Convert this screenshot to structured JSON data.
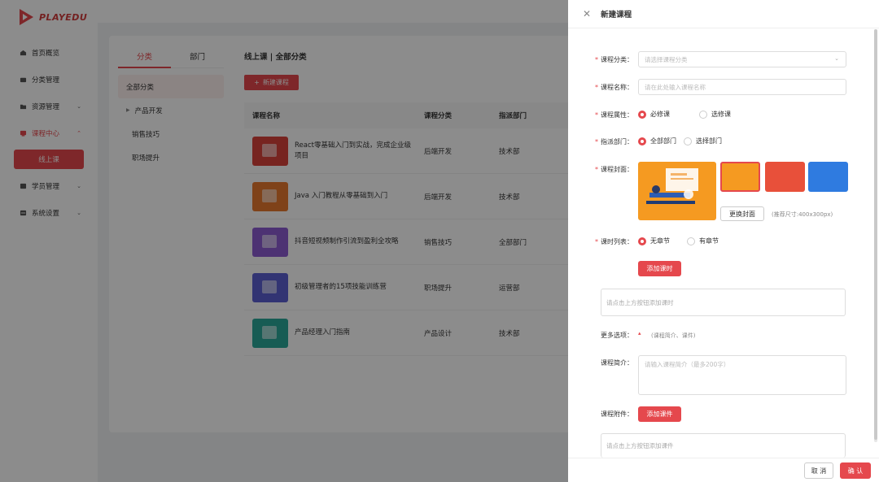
{
  "app": {
    "logo_text": "PLAYEDU",
    "brand_color": "#e5484d"
  },
  "sidebar": {
    "items": [
      {
        "label": "首页概览",
        "icon": "home-icon",
        "expandable": false
      },
      {
        "label": "分类管理",
        "icon": "category-icon",
        "expandable": false
      },
      {
        "label": "资源管理",
        "icon": "folder-icon",
        "expandable": true
      },
      {
        "label": "课程中心",
        "icon": "course-icon",
        "expandable": true,
        "active": true
      },
      {
        "label": "学员管理",
        "icon": "user-icon",
        "expandable": true
      },
      {
        "label": "系统设置",
        "icon": "settings-icon",
        "expandable": true
      }
    ],
    "sub_item_label": "线上课"
  },
  "categories": {
    "tabs": [
      "分类",
      "部门"
    ],
    "items": [
      "全部分类",
      "产品开发",
      "销售技巧",
      "职场提升"
    ]
  },
  "list": {
    "title": "线上课 | 全部分类",
    "new_button": "新建课程",
    "new_button_icon": "plus-icon",
    "columns": [
      "课程名称",
      "课程分类",
      "指派部门"
    ],
    "rows": [
      {
        "name": "React零基础入门到实战，完成企业级项目",
        "category": "后端开发",
        "department": "技术部",
        "color": "#d9433b"
      },
      {
        "name": "Java 入门教程从零基础到入门",
        "category": "后端开发",
        "department": "技术部",
        "color": "#e8782f"
      },
      {
        "name": "抖音短视频制作引流到盈利全攻略",
        "category": "销售技巧",
        "department": "全部部门",
        "color": "#8c5bd1"
      },
      {
        "name": "初级管理者的15项技能训练营",
        "category": "职场提升",
        "department": "运营部",
        "color": "#5b5fd1"
      },
      {
        "name": "产品经理入门指南",
        "category": "产品设计",
        "department": "技术部",
        "color": "#2aa89a"
      }
    ]
  },
  "drawer": {
    "title": "新建课程",
    "close_icon": "close-icon",
    "category_label": "课程分类：",
    "category_placeholder": "请选择课程分类",
    "name_label": "课程名称：",
    "name_placeholder": "请在此处输入课程名称",
    "attr_label": "课程属性：",
    "attr_options": [
      "必修课",
      "选修课"
    ],
    "dept_label": "指派部门：",
    "dept_options": [
      "全部部门",
      "选择部门"
    ],
    "cover_label": "课程封面：",
    "change_cover": "更换封面",
    "cover_hint": "(推荐尺寸:400x300px)",
    "lesson_label": "课时列表：",
    "lesson_options": [
      "无章节",
      "有章节"
    ],
    "add_lesson": "添加课时",
    "lesson_placeholder": "请点击上方按钮添加课时",
    "more_label": "更多选项：",
    "more_hint": "(课程简介、课件)",
    "intro_label": "课程简介：",
    "intro_placeholder": "请输入课程简介（最多200字）",
    "attach_label": "课程附件：",
    "add_attachment": "添加课件",
    "attach_placeholder": "请点击上方按钮添加课件",
    "cancel": "取 消",
    "confirm": "确 认",
    "cover_colors": [
      "#f59a21",
      "#e8503a",
      "#2f7be0"
    ]
  }
}
